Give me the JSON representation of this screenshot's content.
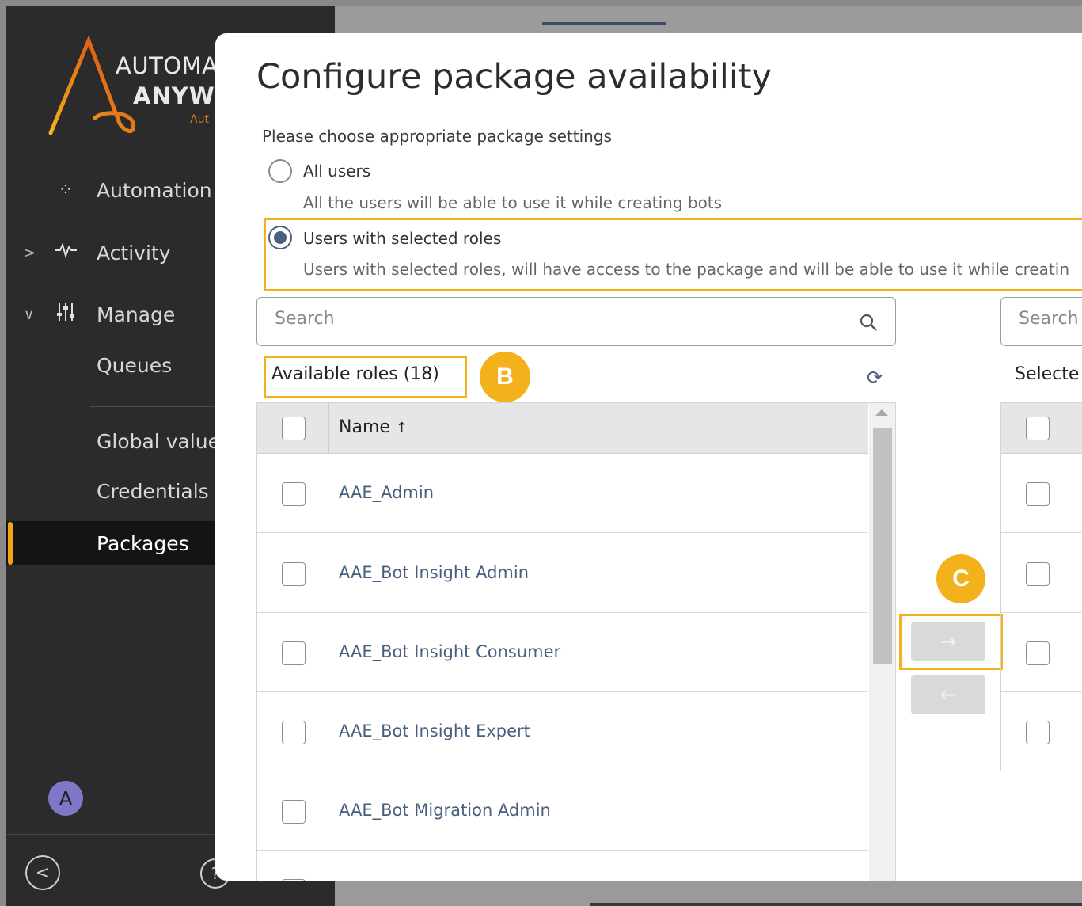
{
  "sidebar": {
    "brand_line1": "AUTOMA",
    "brand_line2": "ANYW",
    "brand_line3": "Aut",
    "nav": [
      {
        "label": "Automation",
        "icon": "dots-cluster-icon"
      },
      {
        "label": "Activity",
        "icon": "pulse-icon"
      },
      {
        "label": "Manage",
        "icon": "sliders-icon"
      },
      {
        "label": "Queues"
      },
      {
        "label": "Global value"
      },
      {
        "label": "Credentials"
      },
      {
        "label": "Packages"
      }
    ],
    "avatar_initial": "A",
    "help_glyph": "?"
  },
  "modal": {
    "title": "Configure package availability",
    "subtitle": "Please choose appropriate package settings",
    "options": [
      {
        "label": "All users",
        "desc": "All the users will be able to use it while creating bots",
        "checked": false
      },
      {
        "label": "Users with selected roles",
        "desc": "Users with selected roles, will have access to the package and will be able to use it while creatin",
        "checked": true
      }
    ],
    "available": {
      "search_placeholder": "Search",
      "label": "Available roles",
      "count": "(18)",
      "column_name": "Name",
      "sort_glyph": "↑",
      "rows": [
        "AAE_Admin",
        "AAE_Bot Insight Admin",
        "AAE_Bot Insight Consumer",
        "AAE_Bot Insight Expert",
        "AAE_Bot Migration Admin"
      ]
    },
    "selected": {
      "search_placeholder": "Search",
      "label": "Selecte"
    },
    "move_right_glyph": "→",
    "move_left_glyph": "←"
  },
  "annotations": {
    "badge_b": "B",
    "badge_c": "C",
    "highlight_color": "#f3b21b"
  },
  "colors": {
    "sidebar_bg": "#2b2b2b",
    "accent": "#f0a31b",
    "link": "#4a5f80"
  }
}
